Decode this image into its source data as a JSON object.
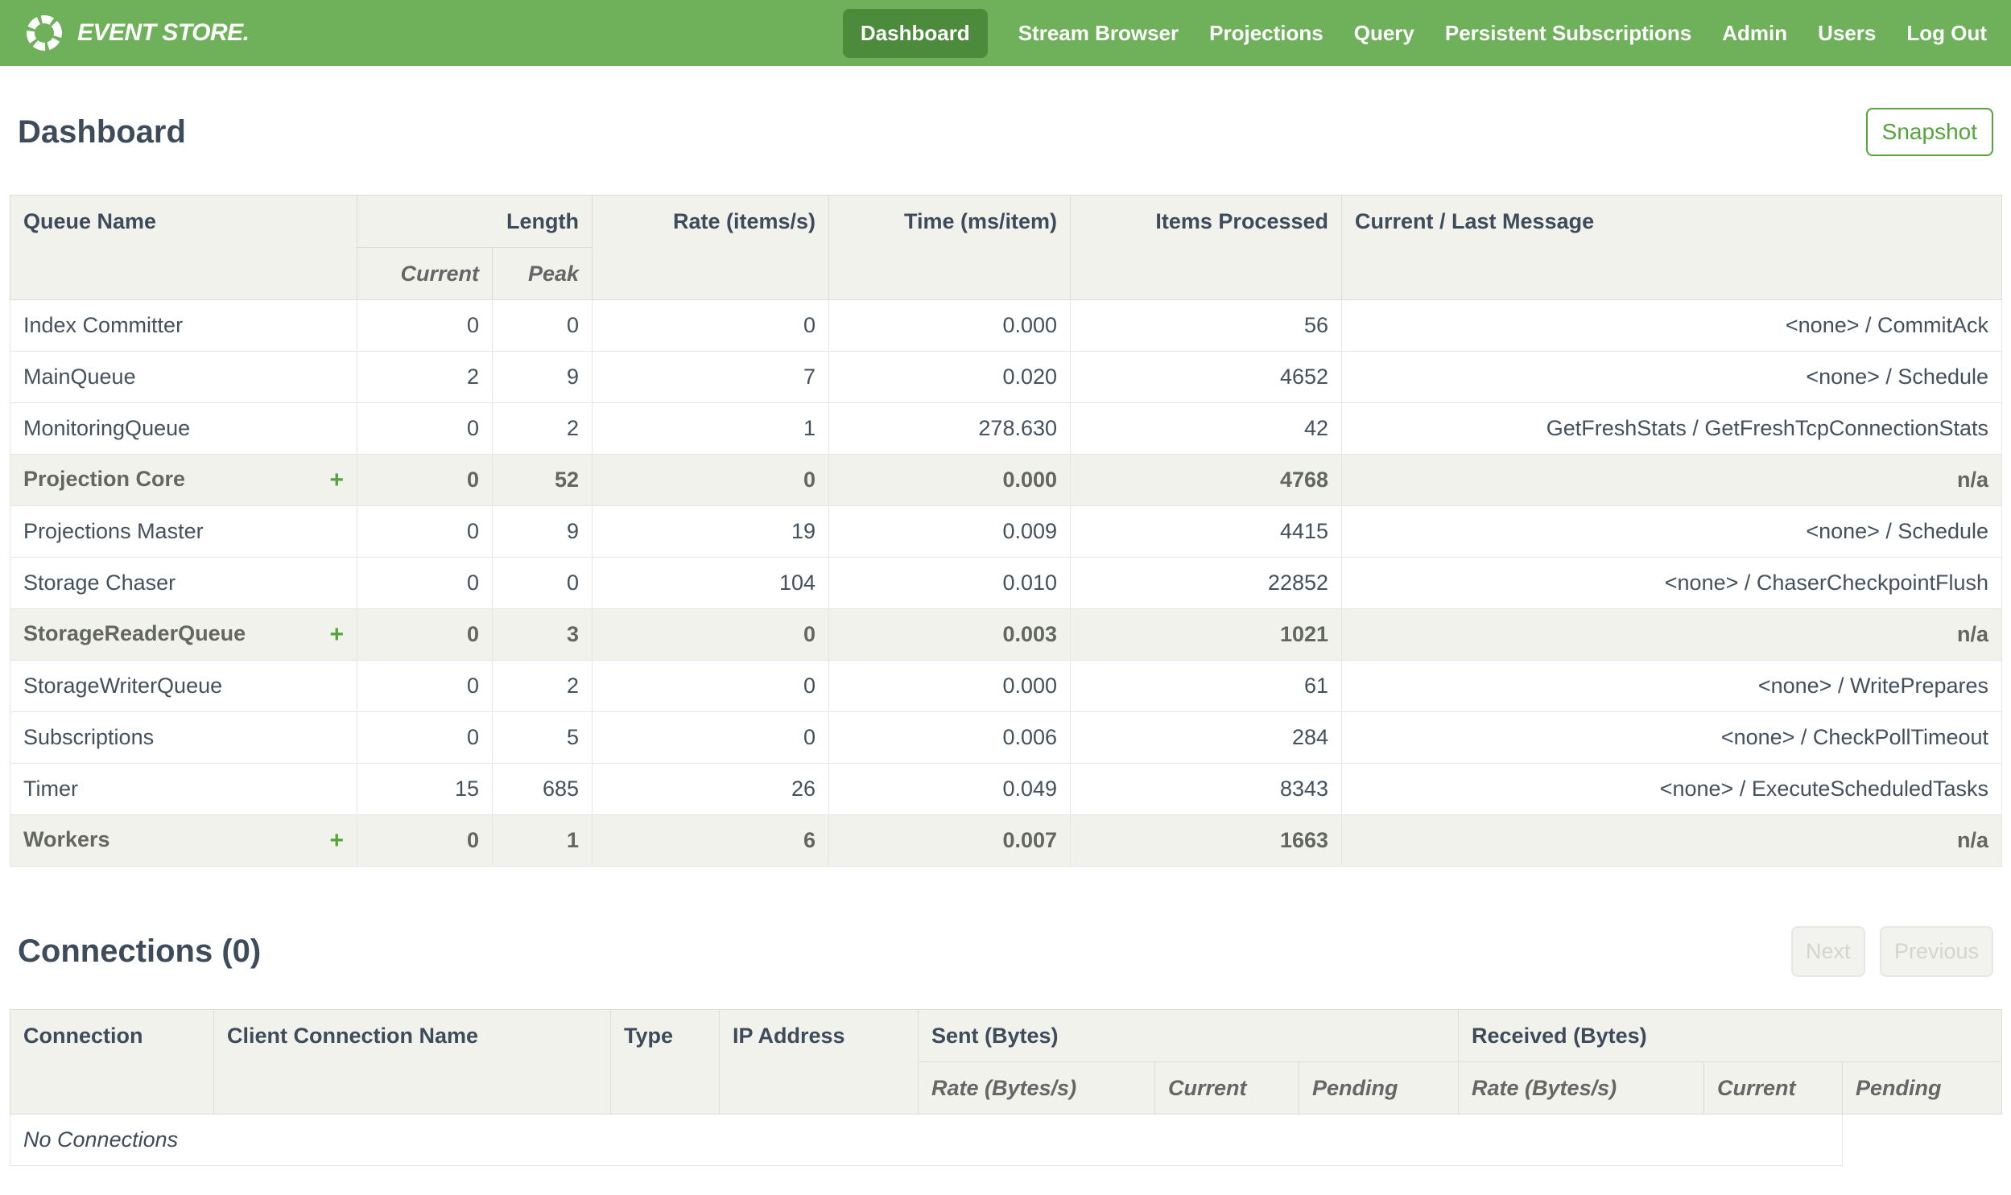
{
  "colors": {
    "nav_green": "#6fb15a",
    "nav_active_green": "#4c8b3b",
    "accent_green": "#55a43e",
    "heading_slate": "#3e4b5b",
    "body_text": "#44505c",
    "table_header_bg": "#f1f2ec",
    "group_text": "#63675e",
    "disabled_text": "#d3d6cb",
    "disabled_bg": "#f2f3ee",
    "disabled_border": "#e7e8e1"
  },
  "nav": {
    "brand": "EVENT STORE.",
    "items": [
      {
        "label": "Dashboard",
        "active": true
      },
      {
        "label": "Stream Browser",
        "active": false
      },
      {
        "label": "Projections",
        "active": false
      },
      {
        "label": "Query",
        "active": false
      },
      {
        "label": "Persistent Subscriptions",
        "active": false
      },
      {
        "label": "Admin",
        "active": false
      },
      {
        "label": "Users",
        "active": false
      },
      {
        "label": "Log Out",
        "active": false
      }
    ]
  },
  "page": {
    "title": "Dashboard",
    "snapshot_label": "Snapshot"
  },
  "queue_table": {
    "headers": {
      "queue_name": "Queue Name",
      "length": "Length",
      "current": "Current",
      "peak": "Peak",
      "rate": "Rate (items/s)",
      "time": "Time (ms/item)",
      "items_processed": "Items Processed",
      "message": "Current / Last Message"
    },
    "expand_symbol": "+",
    "rows": [
      {
        "name": "Index Committer",
        "group": false,
        "expandable": false,
        "current": "0",
        "peak": "0",
        "rate": "0",
        "time": "0.000",
        "items": "56",
        "message": "<none> / CommitAck"
      },
      {
        "name": "MainQueue",
        "group": false,
        "expandable": false,
        "current": "2",
        "peak": "9",
        "rate": "7",
        "time": "0.020",
        "items": "4652",
        "message": "<none> / Schedule"
      },
      {
        "name": "MonitoringQueue",
        "group": false,
        "expandable": false,
        "current": "0",
        "peak": "2",
        "rate": "1",
        "time": "278.630",
        "items": "42",
        "message": "GetFreshStats / GetFreshTcpConnectionStats"
      },
      {
        "name": "Projection Core",
        "group": true,
        "expandable": true,
        "current": "0",
        "peak": "52",
        "rate": "0",
        "time": "0.000",
        "items": "4768",
        "message": "n/a"
      },
      {
        "name": "Projections Master",
        "group": false,
        "expandable": false,
        "current": "0",
        "peak": "9",
        "rate": "19",
        "time": "0.009",
        "items": "4415",
        "message": "<none> / Schedule"
      },
      {
        "name": "Storage Chaser",
        "group": false,
        "expandable": false,
        "current": "0",
        "peak": "0",
        "rate": "104",
        "time": "0.010",
        "items": "22852",
        "message": "<none> / ChaserCheckpointFlush"
      },
      {
        "name": "StorageReaderQueue",
        "group": true,
        "expandable": true,
        "current": "0",
        "peak": "3",
        "rate": "0",
        "time": "0.003",
        "items": "1021",
        "message": "n/a"
      },
      {
        "name": "StorageWriterQueue",
        "group": false,
        "expandable": false,
        "current": "0",
        "peak": "2",
        "rate": "0",
        "time": "0.000",
        "items": "61",
        "message": "<none> / WritePrepares"
      },
      {
        "name": "Subscriptions",
        "group": false,
        "expandable": false,
        "current": "0",
        "peak": "5",
        "rate": "0",
        "time": "0.006",
        "items": "284",
        "message": "<none> / CheckPollTimeout"
      },
      {
        "name": "Timer",
        "group": false,
        "expandable": false,
        "current": "15",
        "peak": "685",
        "rate": "26",
        "time": "0.049",
        "items": "8343",
        "message": "<none> / ExecuteScheduledTasks"
      },
      {
        "name": "Workers",
        "group": true,
        "expandable": true,
        "current": "0",
        "peak": "1",
        "rate": "6",
        "time": "0.007",
        "items": "1663",
        "message": "n/a"
      }
    ]
  },
  "connections": {
    "title": "Connections (0)",
    "next_label": "Next",
    "previous_label": "Previous",
    "headers": {
      "connection": "Connection",
      "client_name": "Client Connection Name",
      "type": "Type",
      "ip": "IP Address",
      "sent": "Sent (Bytes)",
      "received": "Received (Bytes)",
      "rate": "Rate (Bytes/s)",
      "current": "Current",
      "pending": "Pending"
    },
    "empty_text": "No Connections"
  }
}
